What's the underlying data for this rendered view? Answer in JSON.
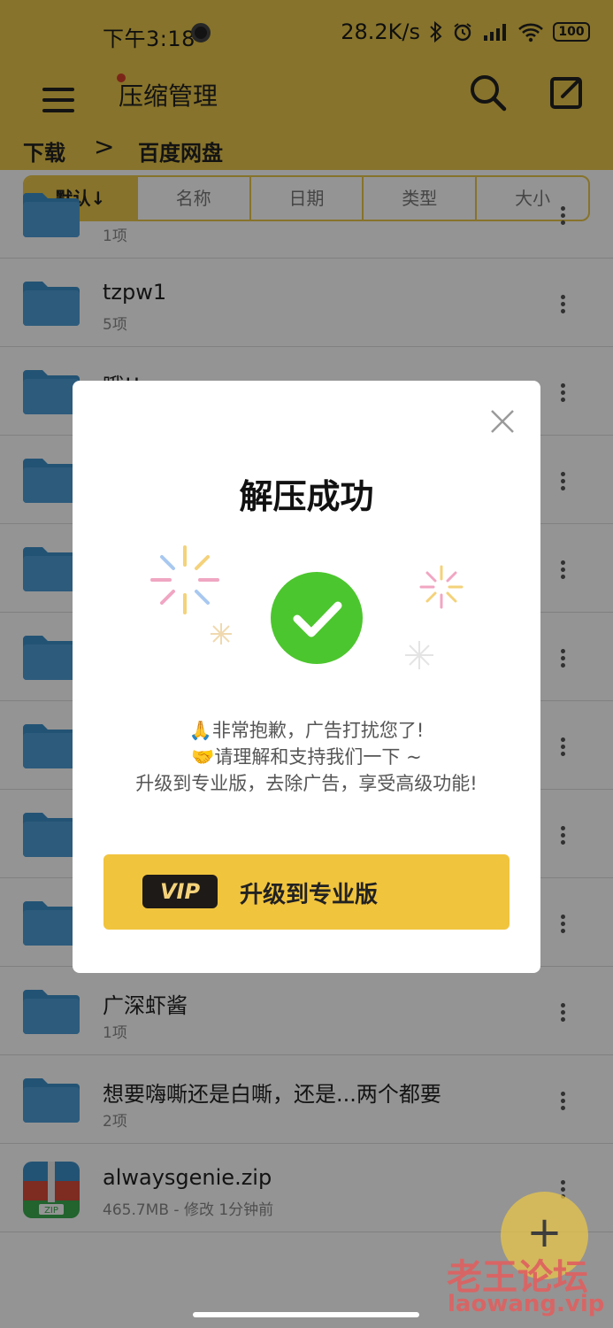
{
  "status_bar": {
    "time": "下午3:18",
    "net_speed": "28.2K/s",
    "battery": "100"
  },
  "app_bar": {
    "title": "压缩管理"
  },
  "breadcrumb": {
    "items": [
      "下载",
      "百度网盘"
    ],
    "separator": ">"
  },
  "sort_tabs": [
    "默认↓",
    "名称",
    "日期",
    "类型",
    "大小"
  ],
  "files": [
    {
      "name": "",
      "meta": "1项"
    },
    {
      "name": "tzpw1",
      "meta": "5项"
    },
    {
      "name": "哦!!",
      "meta": ""
    },
    {
      "name": "",
      "meta": ""
    },
    {
      "name": "",
      "meta": ""
    },
    {
      "name": "",
      "meta": ""
    },
    {
      "name": "",
      "meta": ""
    },
    {
      "name": "",
      "meta": ""
    },
    {
      "name": "",
      "meta": ""
    },
    {
      "name": "广深虾酱",
      "meta": "1项"
    },
    {
      "name": "想要嗨嘶还是白嘶，还是...两个都要",
      "meta": "2项"
    },
    {
      "name": "alwaysgenie.zip",
      "meta": "465.7MB - 修改 1分钟前"
    }
  ],
  "dialog": {
    "title": "解压成功",
    "line1": "🙏非常抱歉，广告打扰您了!",
    "line2": "🤝请理解和支持我们一下 ~",
    "line3": "升级到专业版，去除广告，享受高级功能!",
    "vip_badge": "VIP",
    "vip_button": "升级到专业版"
  },
  "fab": {
    "label": "+"
  },
  "watermark": {
    "line1": "老王论坛",
    "line2": "laowang.vip"
  },
  "colors": {
    "accent": "#e8c64a",
    "success": "#4cc62e",
    "folder": "#3d8fc9"
  }
}
